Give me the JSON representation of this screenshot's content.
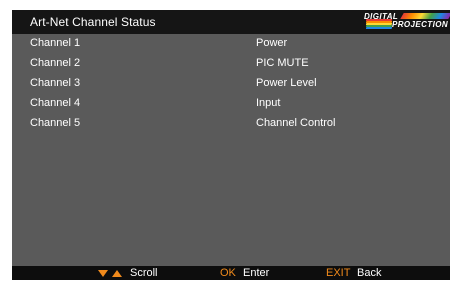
{
  "title": "Art-Net Channel Status",
  "logo": {
    "line1": "DIGITAL",
    "line2": "PROJECTION"
  },
  "rows": [
    {
      "channel": "Channel 1",
      "function": "Power"
    },
    {
      "channel": "Channel 2",
      "function": "PIC MUTE"
    },
    {
      "channel": "Channel 3",
      "function": "Power Level"
    },
    {
      "channel": "Channel 4",
      "function": "Input"
    },
    {
      "channel": "Channel 5",
      "function": "Channel Control"
    }
  ],
  "footer": {
    "scroll_label": "Scroll",
    "ok_key": "OK",
    "ok_label": "Enter",
    "exit_key": "EXIT",
    "exit_label": "Back"
  },
  "colors": {
    "panel_bg": "#5a5a5a",
    "titlebar_bg": "#151515",
    "footer_bg": "#0d0d0d",
    "key_accent": "#f08a1c",
    "text": "#ffffff"
  },
  "icons": {
    "scroll": "up-down-arrows-icon",
    "logo": "digital-projection-logo"
  }
}
